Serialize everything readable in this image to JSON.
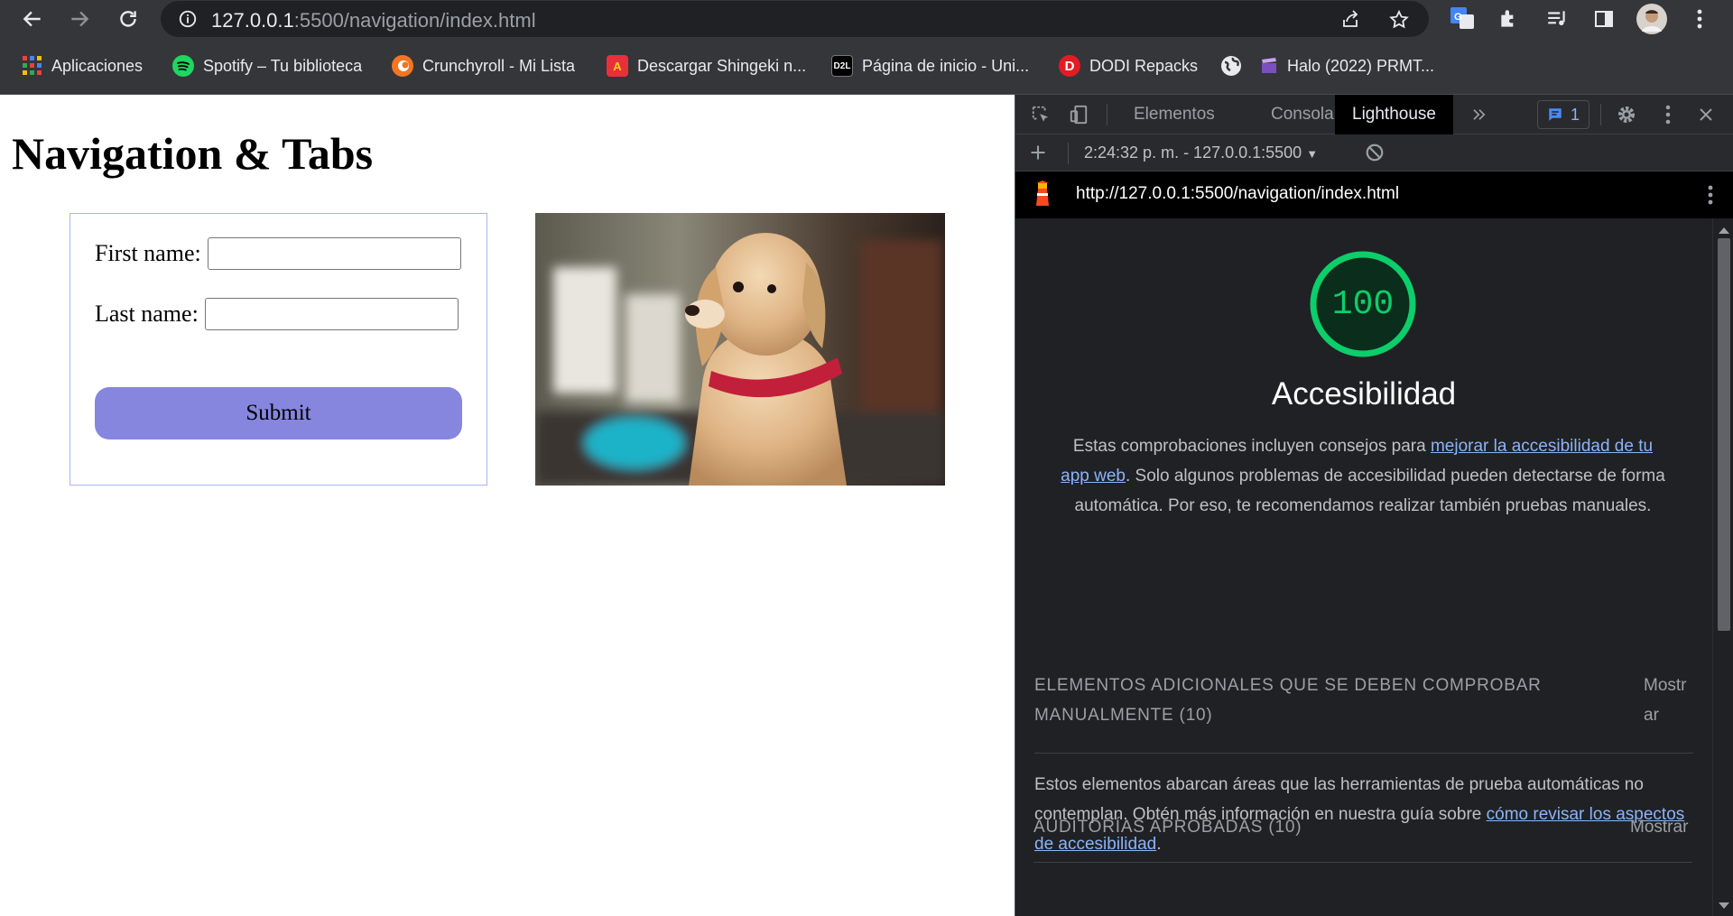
{
  "browser": {
    "url_host": "127.0.0.1",
    "url_path": ":5500/navigation/index.html",
    "bookmarks": [
      {
        "label": "Aplicaciones",
        "icon": "apps-grid-icon"
      },
      {
        "label": "Spotify – Tu biblioteca",
        "icon": "spotify-icon"
      },
      {
        "label": "Crunchyroll - Mi Lista",
        "icon": "crunchyroll-icon"
      },
      {
        "label": "Descargar Shingeki n...",
        "icon": "letter-a-icon"
      },
      {
        "label": "Página de inicio - Uni...",
        "icon": "d2l-icon"
      },
      {
        "label": "DODI Repacks",
        "icon": "dodi-icon"
      },
      {
        "label": "",
        "icon": "globe-icon"
      },
      {
        "label": "Halo (2022) PRMT...",
        "icon": "clapperboard-icon"
      }
    ],
    "favicon_text": {
      "d2l": "D2L",
      "dodi": "D",
      "letter_a": "A"
    }
  },
  "page": {
    "heading": "Navigation & Tabs",
    "first_name_label": "First name:",
    "last_name_label": "Last name:",
    "submit_label": "Submit",
    "photo": "puppy-photo"
  },
  "devtools": {
    "tabs": [
      "Elementos",
      "Consola",
      "Lighthouse"
    ],
    "active_tab": "Lighthouse",
    "issues_count": "1",
    "report_time": "2:24:32 p. m. - 127.0.0.1:5500",
    "report_url": "http://127.0.0.1:5500/navigation/index.html",
    "lighthouse": {
      "score": "100",
      "category": "Accesibilidad",
      "desc_before": "Estas comprobaciones incluyen consejos para ",
      "desc_link": "mejorar la accesibilidad de tu app web",
      "desc_after": ". Solo algunos problemas de accesibilidad pueden detectarse de forma automática. Por eso, te recomendamos realizar también pruebas manuales.",
      "manual_group_title": "ELEMENTOS ADICIONALES QUE SE DEBEN COMPROBAR MANUALMENTE (10)",
      "manual_group_toggle": "Mostrar",
      "manual_note_before": "Estos elementos abarcan áreas que las herramientas de prueba automáticas no contemplan. Obtén más información en nuestra guía sobre ",
      "manual_note_link": "cómo revisar los aspectos de accesibilidad",
      "manual_note_after": ".",
      "passed_group_title": "AUDITORÍAS APROBADAS (10)",
      "passed_group_toggle": "Mostrar"
    }
  },
  "colors": {
    "score_pass": "#0cce6b",
    "submit_button": "#8686df",
    "link": "#8ab4f8",
    "form_border": "#aab4ee"
  }
}
